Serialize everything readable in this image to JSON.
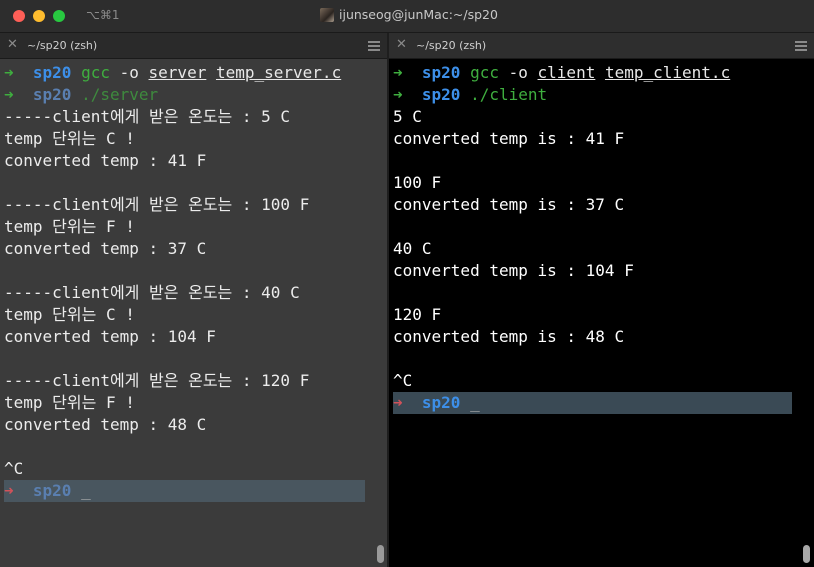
{
  "window": {
    "shortcut": "⌥⌘1",
    "title": "ijunseog@junMac:~/sp20",
    "avatar_icon": "user-avatar"
  },
  "colors": {
    "prompt_arrow_ok": "#3fae3f",
    "prompt_arrow_last": "#d0525a",
    "dir": "#3d8fe8",
    "left_bg": "#3b3b3b",
    "right_bg": "#000000"
  },
  "left": {
    "tab_title": "~/sp20 (zsh)",
    "prompt1": {
      "arrow": "➜",
      "dir": "sp20",
      "cmd": "gcc",
      "flag": "-o",
      "arg1": "server",
      "arg2": "temp_server.c"
    },
    "prompt2": {
      "arrow": "➜",
      "dir": "sp20",
      "cmd": "./server"
    },
    "output": [
      "-----client에게 받은 온도는 : 5 C",
      "temp 단위는 C !",
      "converted temp : 41 F",
      "",
      "-----client에게 받은 온도는 : 100 F",
      "temp 단위는 F !",
      "converted temp : 37 C",
      "",
      "-----client에게 받은 온도는 : 40 C",
      "temp 단위는 C !",
      "converted temp : 104 F",
      "",
      "-----client에게 받은 온도는 : 120 F",
      "temp 단위는 F !",
      "converted temp : 48 C",
      "",
      "^C"
    ],
    "last_prompt": {
      "arrow": "➜",
      "dir": "sp20",
      "cursor": "_"
    }
  },
  "right": {
    "tab_title": "~/sp20 (zsh)",
    "prompt1": {
      "arrow": "➜",
      "dir": "sp20",
      "cmd": "gcc",
      "flag": "-o",
      "arg1": "client",
      "arg2": "temp_client.c"
    },
    "prompt2": {
      "arrow": "➜",
      "dir": "sp20",
      "cmd": "./client"
    },
    "output": [
      "5 C",
      "converted temp is : 41 F",
      "",
      "100 F",
      "converted temp is : 37 C",
      "",
      "40 C",
      "converted temp is : 104 F",
      "",
      "120 F",
      "converted temp is : 48 C",
      "",
      "^C"
    ],
    "last_prompt": {
      "arrow": "➜",
      "dir": "sp20",
      "cursor": "_"
    }
  }
}
